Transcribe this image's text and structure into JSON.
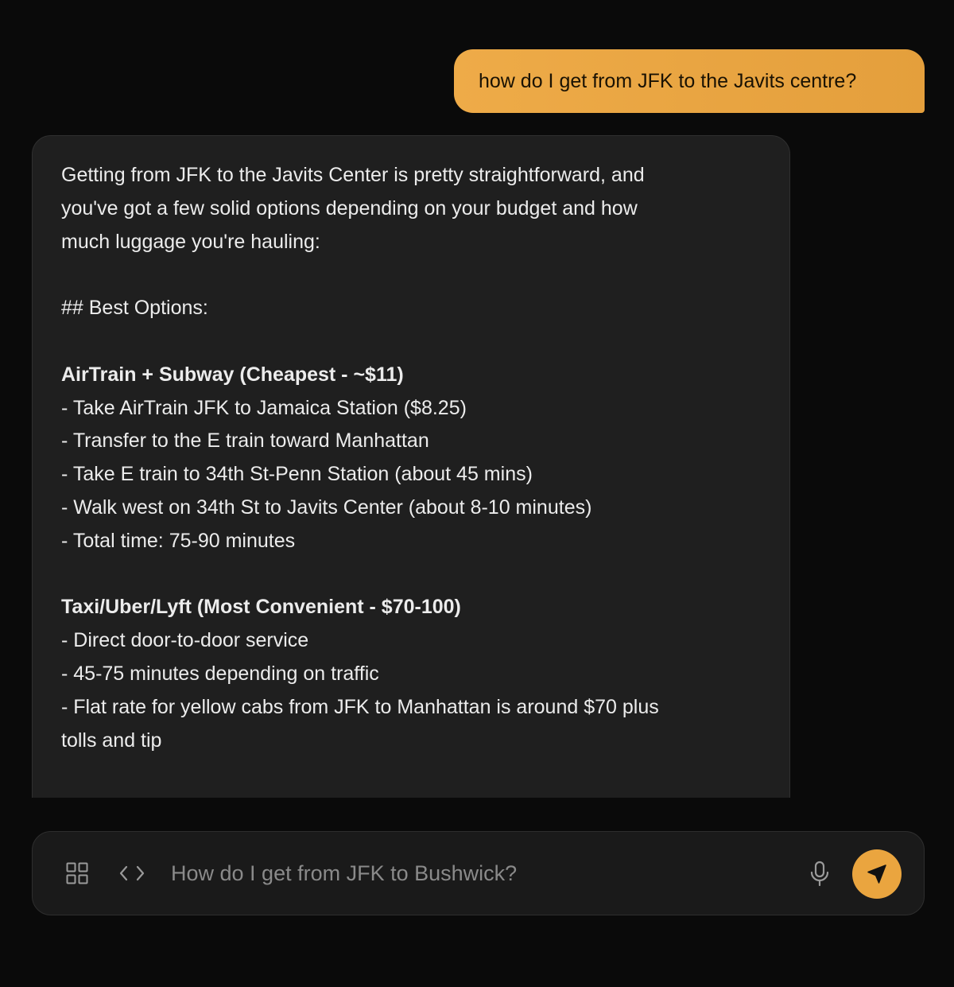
{
  "conversation": {
    "user_message": "how do I get from JFK to the Javits centre?",
    "assistant_lines": [
      {
        "text": "Getting from JFK to the Javits Center is pretty straightforward, and",
        "bold": false
      },
      {
        "text": "you've got a few solid options depending on your budget and how",
        "bold": false
      },
      {
        "text": "much luggage you're hauling:",
        "bold": false
      },
      {
        "text": "",
        "bold": false
      },
      {
        "text": "## Best Options:",
        "bold": false
      },
      {
        "text": "",
        "bold": false
      },
      {
        "text": "AirTrain + Subway (Cheapest - ~$11)",
        "bold": true
      },
      {
        "text": "- Take AirTrain JFK to Jamaica Station ($8.25)",
        "bold": false
      },
      {
        "text": "- Transfer to the E train toward Manhattan",
        "bold": false
      },
      {
        "text": "- Take E train to 34th St-Penn Station (about 45 mins)",
        "bold": false
      },
      {
        "text": "- Walk west on 34th St to Javits Center (about 8-10 minutes)",
        "bold": false
      },
      {
        "text": "- Total time: 75-90 minutes",
        "bold": false
      },
      {
        "text": "",
        "bold": false
      },
      {
        "text": "Taxi/Uber/Lyft (Most Convenient - $70-100)",
        "bold": true
      },
      {
        "text": "- Direct door-to-door service",
        "bold": false
      },
      {
        "text": "- 45-75 minutes depending on traffic",
        "bold": false
      },
      {
        "text": "- Flat rate for yellow cabs from JFK to Manhattan is around $70 plus",
        "bold": false
      },
      {
        "text": "tolls and tip",
        "bold": false
      }
    ]
  },
  "composer": {
    "placeholder": "How do I get from JFK to Bushwick?",
    "icons": {
      "grid": "grid-icon",
      "code": "code-icon",
      "mic": "microphone-icon",
      "send": "send-arrow-icon"
    }
  },
  "colors": {
    "background": "#0a0a0a",
    "user_bubble": "#eaa53f",
    "assistant_bubble": "#1f1f1f",
    "send_button": "#eaa53f"
  }
}
